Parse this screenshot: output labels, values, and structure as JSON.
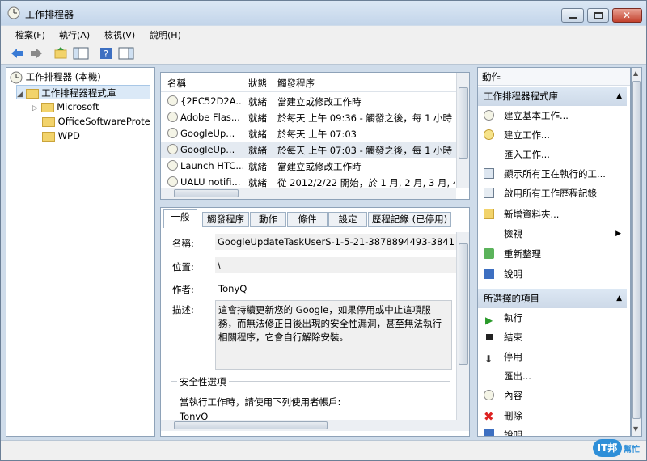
{
  "window": {
    "title": "工作排程器"
  },
  "menu": [
    "檔案(F)",
    "執行(A)",
    "檢視(V)",
    "說明(H)"
  ],
  "tree": {
    "root": "工作排程器 (本機)",
    "library": "工作排程器程式庫",
    "children": [
      "Microsoft",
      "OfficeSoftwareProte",
      "WPD"
    ]
  },
  "tasks": {
    "columns": [
      "名稱",
      "狀態",
      "觸發程序"
    ],
    "rows": [
      {
        "name": "{2EC52D2A...",
        "status": "就緒",
        "trigger": "當建立或修改工作時"
      },
      {
        "name": "Adobe Flas...",
        "status": "就緒",
        "trigger": "於每天 上午 09:36 - 觸發之後，每 1 小時"
      },
      {
        "name": "GoogleUp...",
        "status": "就緒",
        "trigger": "於每天 上午 07:03"
      },
      {
        "name": "GoogleUp...",
        "status": "就緒",
        "trigger": "於每天 上午 07:03 - 觸發之後，每 1 小時"
      },
      {
        "name": "Launch HTC...",
        "status": "就緒",
        "trigger": "當建立或修改工作時"
      },
      {
        "name": "UALU notifi...",
        "status": "就緒",
        "trigger": "從 2012/2/22 開始，於 1 月, 2 月, 3 月, 4"
      }
    ]
  },
  "detail": {
    "tabs": [
      "一般",
      "觸發程序",
      "動作",
      "條件",
      "設定",
      "歷程記錄 (已停用)"
    ],
    "name_label": "名稱:",
    "name_value": "GoogleUpdateTaskUserS-1-5-21-3878894493-3841",
    "location_label": "位置:",
    "location_value": "\\",
    "author_label": "作者:",
    "author_value": "TonyQ",
    "desc_label": "描述:",
    "description": "這會持續更新您的 Google，如果停用或中止這項服務，而無法修正日後出現的安全性漏洞，甚至無法執行相關程序，它會自行解除安裝。",
    "security_title": "安全性選項",
    "security_text": "當執行工作時，請使用下列使用者帳戶:",
    "security_user": "TonyQ"
  },
  "actions": {
    "header": "動作",
    "section1": "工作排程器程式庫",
    "items1": [
      "建立基本工作...",
      "建立工作...",
      "匯入工作...",
      "顯示所有正在執行的工...",
      "啟用所有工作歷程記錄",
      "新增資料夾...",
      "檢視",
      "重新整理",
      "說明"
    ],
    "section2": "所選擇的項目",
    "items2": [
      "執行",
      "結束",
      "停用",
      "匯出...",
      "內容",
      "刪除",
      "說明"
    ]
  },
  "watermark": {
    "text": "IT邦",
    "sub": "幫忙"
  },
  "colors": {
    "accent": "#3b6ea5",
    "selection": "#dbe9f7"
  }
}
